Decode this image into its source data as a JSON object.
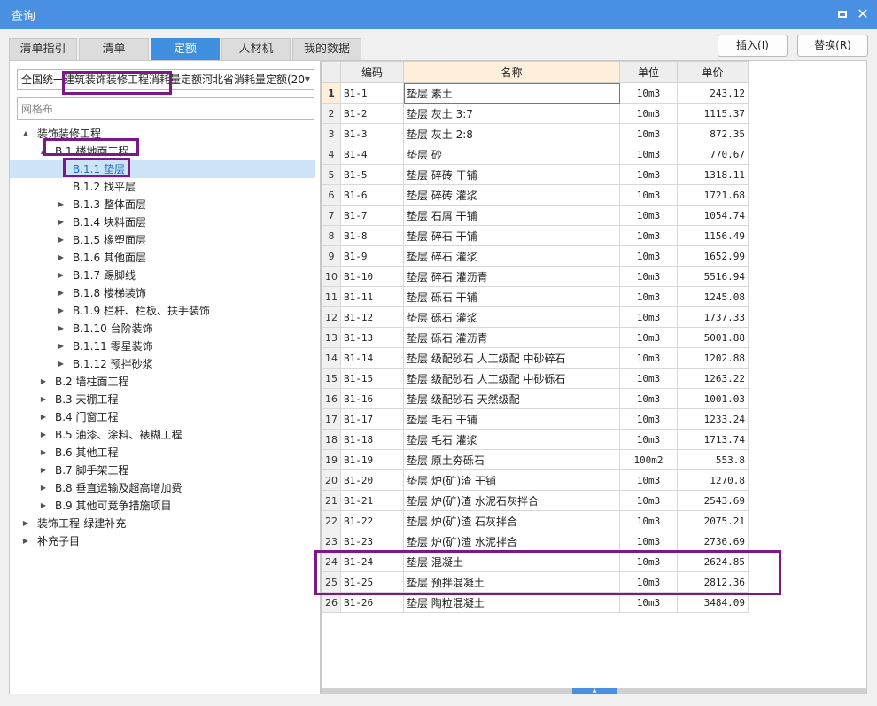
{
  "window": {
    "title": "查询",
    "max_icon": "maximize-icon",
    "close_icon": "close-icon"
  },
  "tabs": [
    {
      "label": "清单指引",
      "active": false
    },
    {
      "label": "清单",
      "active": false
    },
    {
      "label": "定额",
      "active": true
    },
    {
      "label": "人材机",
      "active": false
    },
    {
      "label": "我的数据",
      "active": false
    }
  ],
  "actions": {
    "insert_label": "插入(I)",
    "replace_label": "替换(R)"
  },
  "left": {
    "quota_library": "全国统一建筑装饰装修工程消耗量定额河北省消耗量定额(20",
    "search_placeholder": "网格布"
  },
  "tree": [
    {
      "label": "装饰装修工程",
      "toggle": "▲"
    },
    {
      "label": "B.1 楼地面工程",
      "toggle": "▲"
    },
    {
      "label": "B.1.1 垫层",
      "toggle": "",
      "selected": true
    },
    {
      "label": "B.1.2 找平层",
      "toggle": ""
    },
    {
      "label": "B.1.3 整体面层",
      "toggle": "▶"
    },
    {
      "label": "B.1.4 块料面层",
      "toggle": "▶"
    },
    {
      "label": "B.1.5 橡塑面层",
      "toggle": "▶"
    },
    {
      "label": "B.1.6 其他面层",
      "toggle": "▶"
    },
    {
      "label": "B.1.7 踢脚线",
      "toggle": "▶"
    },
    {
      "label": "B.1.8 楼梯装饰",
      "toggle": "▶"
    },
    {
      "label": "B.1.9 栏杆、栏板、扶手装饰",
      "toggle": "▶"
    },
    {
      "label": "B.1.10 台阶装饰",
      "toggle": "▶"
    },
    {
      "label": "B.1.11 零星装饰",
      "toggle": "▶"
    },
    {
      "label": "B.1.12 预拌砂浆",
      "toggle": "▶"
    },
    {
      "label": "B.2 墙柱面工程",
      "toggle": "▶"
    },
    {
      "label": "B.3 天棚工程",
      "toggle": "▶"
    },
    {
      "label": "B.4 门窗工程",
      "toggle": "▶"
    },
    {
      "label": "B.5 油漆、涂料、裱糊工程",
      "toggle": "▶"
    },
    {
      "label": "B.6 其他工程",
      "toggle": "▶"
    },
    {
      "label": "B.7 脚手架工程",
      "toggle": "▶"
    },
    {
      "label": "B.8 垂直运输及超高增加费",
      "toggle": "▶"
    },
    {
      "label": "B.9 其他可竞争措施项目",
      "toggle": "▶"
    },
    {
      "label": "装饰工程-绿建补充",
      "toggle": "▶"
    },
    {
      "label": "补充子目",
      "toggle": "▶"
    }
  ],
  "grid": {
    "headers": {
      "code": "编码",
      "name": "名称",
      "unit": "单位",
      "price": "单价"
    },
    "rows": [
      {
        "idx": "1",
        "code": "B1-1",
        "name": "垫层 素土",
        "unit": "10m3",
        "price": "243.12"
      },
      {
        "idx": "2",
        "code": "B1-2",
        "name": "垫层 灰土 3:7",
        "unit": "10m3",
        "price": "1115.37"
      },
      {
        "idx": "3",
        "code": "B1-3",
        "name": "垫层 灰土 2:8",
        "unit": "10m3",
        "price": "872.35"
      },
      {
        "idx": "4",
        "code": "B1-4",
        "name": "垫层 砂",
        "unit": "10m3",
        "price": "770.67"
      },
      {
        "idx": "5",
        "code": "B1-5",
        "name": "垫层 碎砖 干铺",
        "unit": "10m3",
        "price": "1318.11"
      },
      {
        "idx": "6",
        "code": "B1-6",
        "name": "垫层 碎砖 灌浆",
        "unit": "10m3",
        "price": "1721.68"
      },
      {
        "idx": "7",
        "code": "B1-7",
        "name": "垫层 石屑 干铺",
        "unit": "10m3",
        "price": "1054.74"
      },
      {
        "idx": "8",
        "code": "B1-8",
        "name": "垫层 碎石 干铺",
        "unit": "10m3",
        "price": "1156.49"
      },
      {
        "idx": "9",
        "code": "B1-9",
        "name": "垫层 碎石 灌浆",
        "unit": "10m3",
        "price": "1652.99"
      },
      {
        "idx": "10",
        "code": "B1-10",
        "name": "垫层 碎石 灌沥青",
        "unit": "10m3",
        "price": "5516.94"
      },
      {
        "idx": "11",
        "code": "B1-11",
        "name": "垫层 砾石 干铺",
        "unit": "10m3",
        "price": "1245.08"
      },
      {
        "idx": "12",
        "code": "B1-12",
        "name": "垫层 砾石 灌浆",
        "unit": "10m3",
        "price": "1737.33"
      },
      {
        "idx": "13",
        "code": "B1-13",
        "name": "垫层 砾石 灌沥青",
        "unit": "10m3",
        "price": "5001.88"
      },
      {
        "idx": "14",
        "code": "B1-14",
        "name": "垫层 级配砂石 人工级配 中砂碎石",
        "unit": "10m3",
        "price": "1202.88"
      },
      {
        "idx": "15",
        "code": "B1-15",
        "name": "垫层 级配砂石 人工级配 中砂砾石",
        "unit": "10m3",
        "price": "1263.22"
      },
      {
        "idx": "16",
        "code": "B1-16",
        "name": "垫层 级配砂石 天然级配",
        "unit": "10m3",
        "price": "1001.03"
      },
      {
        "idx": "17",
        "code": "B1-17",
        "name": "垫层 毛石 干铺",
        "unit": "10m3",
        "price": "1233.24"
      },
      {
        "idx": "18",
        "code": "B1-18",
        "name": "垫层 毛石 灌浆",
        "unit": "10m3",
        "price": "1713.74"
      },
      {
        "idx": "19",
        "code": "B1-19",
        "name": "垫层 原土夯砾石",
        "unit": "100m2",
        "price": "553.8"
      },
      {
        "idx": "20",
        "code": "B1-20",
        "name": "垫层 炉(矿)渣 干铺",
        "unit": "10m3",
        "price": "1270.8"
      },
      {
        "idx": "21",
        "code": "B1-21",
        "name": "垫层 炉(矿)渣 水泥石灰拌合",
        "unit": "10m3",
        "price": "2543.69"
      },
      {
        "idx": "22",
        "code": "B1-22",
        "name": "垫层 炉(矿)渣 石灰拌合",
        "unit": "10m3",
        "price": "2075.21"
      },
      {
        "idx": "23",
        "code": "B1-23",
        "name": "垫层 炉(矿)渣 水泥拌合",
        "unit": "10m3",
        "price": "2736.69"
      },
      {
        "idx": "24",
        "code": "B1-24",
        "name": "垫层 混凝土",
        "unit": "10m3",
        "price": "2624.85"
      },
      {
        "idx": "25",
        "code": "B1-25",
        "name": "垫层 预拌混凝土",
        "unit": "10m3",
        "price": "2812.36"
      },
      {
        "idx": "26",
        "code": "B1-26",
        "name": "垫层 陶粒混凝土",
        "unit": "10m3",
        "price": "3484.09"
      }
    ]
  },
  "colors": {
    "titlebar": "#4a90e2",
    "active_tab": "#3f8fde",
    "selection": "#cde3f7",
    "annotation": "#7b1a86"
  }
}
